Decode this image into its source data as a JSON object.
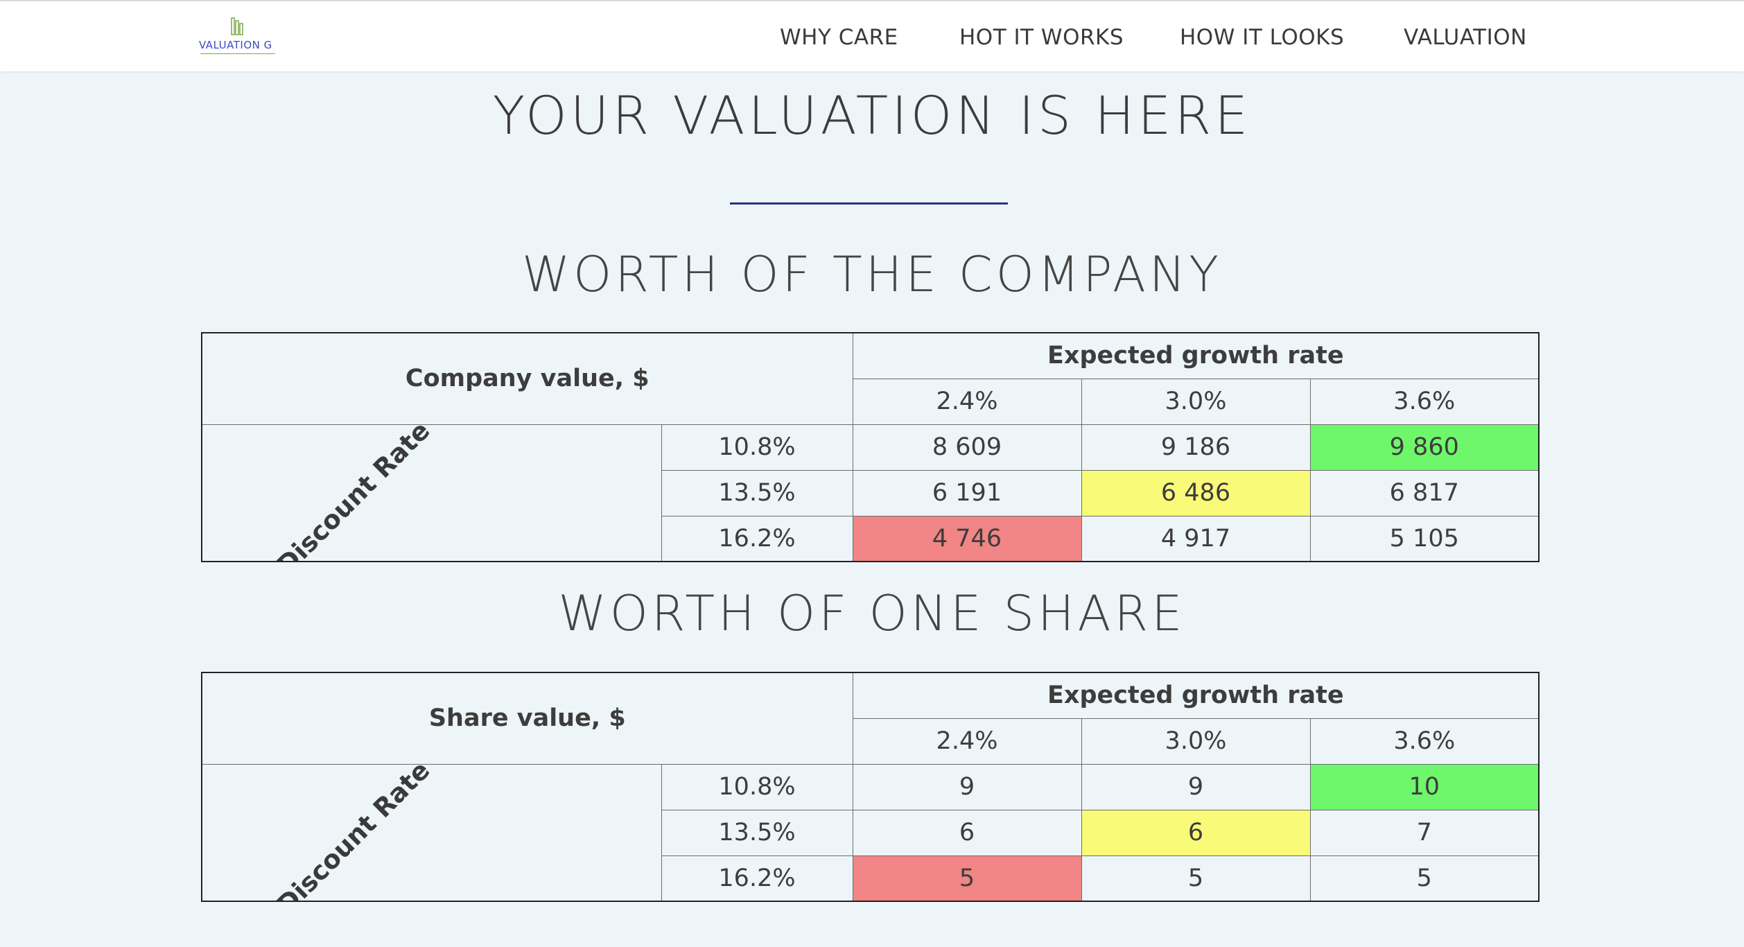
{
  "nav": {
    "logo_text": "VALUATION G",
    "items": [
      "WHY CARE",
      "HOT IT WORKS",
      "HOW IT LOOKS",
      "VALUATION"
    ]
  },
  "page": {
    "title": "YOUR VALUATION IS HERE"
  },
  "sections": [
    {
      "heading": "WORTH OF THE COMPANY",
      "table_title": "Company value, $",
      "column_group": "Expected growth rate",
      "row_group": "Discount Rate",
      "growth_rates": [
        "2.4%",
        "3.0%",
        "3.6%"
      ],
      "rows": [
        {
          "rate": "10.8%",
          "values": [
            "8 609",
            "9 186",
            "9 860"
          ]
        },
        {
          "rate": "13.5%",
          "values": [
            "6 191",
            "6 486",
            "6 817"
          ]
        },
        {
          "rate": "16.2%",
          "values": [
            "4 746",
            "4 917",
            "5 105"
          ]
        }
      ]
    },
    {
      "heading": "WORTH OF ONE SHARE",
      "table_title": "Share value, $",
      "column_group": "Expected growth rate",
      "row_group": "Discount Rate",
      "growth_rates": [
        "2.4%",
        "3.0%",
        "3.6%"
      ],
      "rows": [
        {
          "rate": "10.8%",
          "values": [
            "9",
            "9",
            "10"
          ]
        },
        {
          "rate": "13.5%",
          "values": [
            "6",
            "6",
            "7"
          ]
        },
        {
          "rate": "16.2%",
          "values": [
            "5",
            "5",
            "5"
          ]
        }
      ]
    }
  ],
  "highlight_colors": {
    "best": "#6ef76a",
    "base": "#fafa79",
    "worst": "#f28585"
  }
}
